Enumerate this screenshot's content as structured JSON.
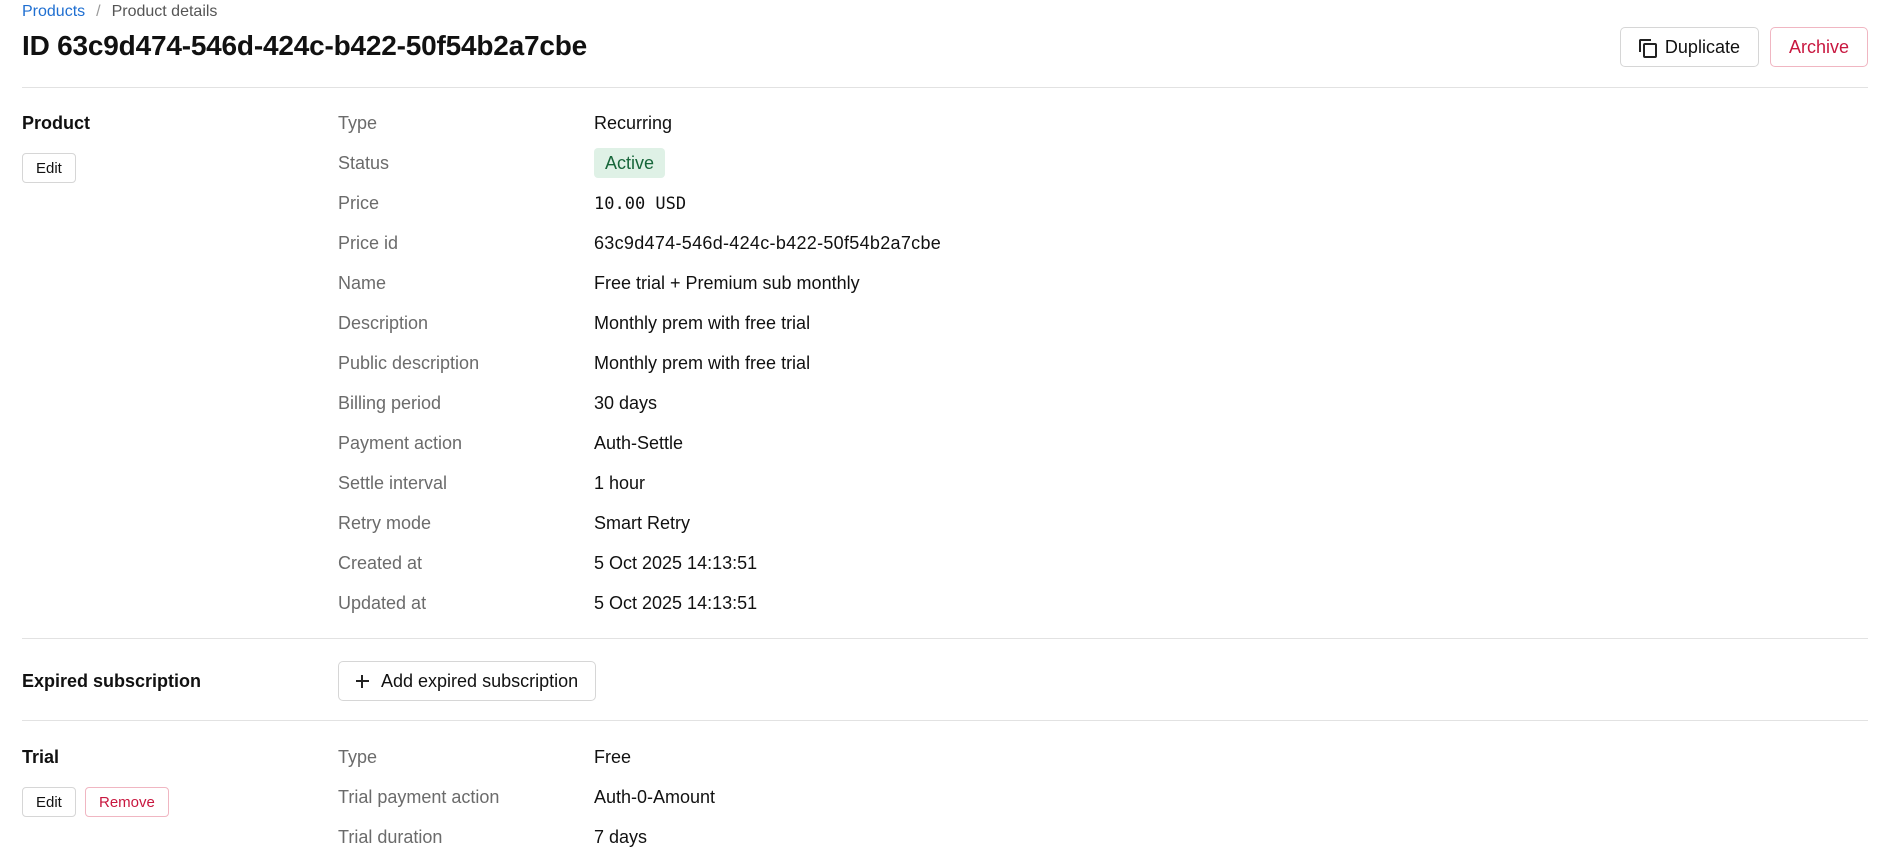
{
  "breadcrumb": {
    "root": "Products",
    "separator": "/",
    "current": "Product details"
  },
  "header": {
    "title": "ID 63c9d474-546d-424c-b422-50f54b2a7cbe",
    "duplicate_label": "Duplicate",
    "archive_label": "Archive"
  },
  "product": {
    "section_title": "Product",
    "edit_label": "Edit",
    "fields": {
      "type": {
        "label": "Type",
        "value": "Recurring"
      },
      "status": {
        "label": "Status",
        "value": "Active"
      },
      "price": {
        "label": "Price",
        "value": "10.00 USD"
      },
      "price_id": {
        "label": "Price id",
        "value": "63c9d474-546d-424c-b422-50f54b2a7cbe"
      },
      "name": {
        "label": "Name",
        "value": "Free trial + Premium sub monthly"
      },
      "description": {
        "label": "Description",
        "value": "Monthly prem with free trial"
      },
      "public_description": {
        "label": "Public description",
        "value": "Monthly prem with free trial"
      },
      "billing_period": {
        "label": "Billing period",
        "value": "30 days"
      },
      "payment_action": {
        "label": "Payment action",
        "value": "Auth-Settle"
      },
      "settle_interval": {
        "label": "Settle interval",
        "value": "1 hour"
      },
      "retry_mode": {
        "label": "Retry mode",
        "value": "Smart Retry"
      },
      "created_at": {
        "label": "Created at",
        "value": "5 Oct 2025 14:13:51"
      },
      "updated_at": {
        "label": "Updated at",
        "value": "5 Oct 2025 14:13:51"
      }
    }
  },
  "expired_subscription": {
    "section_title": "Expired subscription",
    "add_label": "Add expired subscription"
  },
  "trial": {
    "section_title": "Trial",
    "edit_label": "Edit",
    "remove_label": "Remove",
    "fields": {
      "type": {
        "label": "Type",
        "value": "Free"
      },
      "payment_action": {
        "label": "Trial payment action",
        "value": "Auth-0-Amount"
      },
      "duration": {
        "label": "Trial duration",
        "value": "7 days"
      }
    }
  },
  "colors": {
    "link": "#1f6fd1",
    "danger": "#c8173f",
    "status_active_bg": "#dff1e6",
    "status_active_text": "#17663a"
  }
}
